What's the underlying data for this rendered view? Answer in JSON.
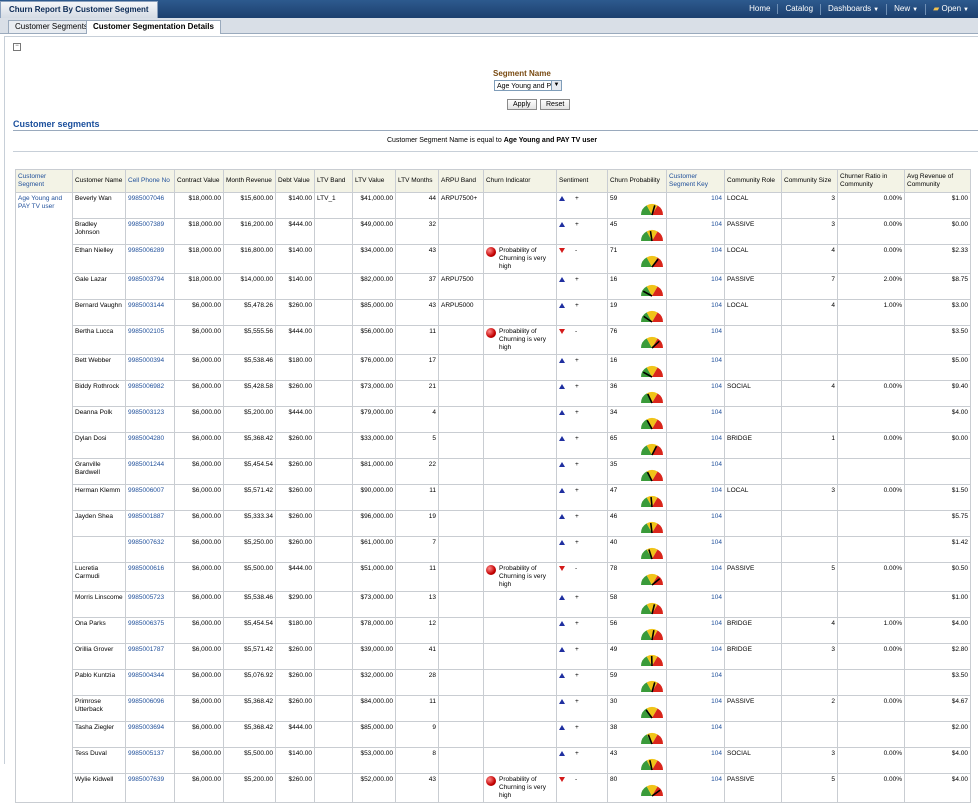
{
  "app": {
    "title": "Churn Report By Customer Segment",
    "nav": [
      "Home",
      "Catalog",
      "Dashboards",
      "New",
      "Open"
    ]
  },
  "tabs": [
    "Customer Segments",
    "Customer Segmentation Details"
  ],
  "prompt": {
    "label": "Segment Name",
    "selected": "Age Young and P",
    "apply": "Apply",
    "reset": "Reset"
  },
  "section": {
    "title": "Customer segments",
    "filter_prefix": "Customer Segment Name is equal to",
    "filter_value": "Age Young and PAY TV user"
  },
  "colors": {
    "topbar": "#1c3f6e",
    "link": "#1f4f9a",
    "header_bg": "#f3f3e6",
    "alert": "#c40000",
    "up": "#1f2fa0",
    "down": "#d41a1a"
  },
  "table": {
    "headers": [
      "Customer Segment",
      "Customer Name",
      "Cell Phone No",
      "Contract Value",
      "Month Revenue",
      "Debt Value",
      "LTV Band",
      "LTV Value",
      "LTV Months",
      "ARPU Band",
      "Churn Indicator",
      "Sentiment",
      "Churn Probability",
      "Customer Segment Key",
      "Community Role",
      "Community Size",
      "Churner Ratio in Community",
      "Avg Revenue of Community"
    ],
    "segment_name": "Age Young and PAY TV user",
    "indicator_text": "Probability of Churning is very high",
    "rows": [
      {
        "name": "Beverly Wan",
        "phone": "9985007046",
        "contract": "$18,000.00",
        "month": "$15,600.00",
        "debt": "$140.00",
        "ltvband": "LTV_1",
        "ltv": "$41,000.00",
        "months": "44",
        "arpu": "ARPU7500+",
        "ind": false,
        "sent": "up",
        "sign": "+",
        "prob": "59",
        "key": "104",
        "role": "LOCAL",
        "size": "3",
        "ratio": "0.00%",
        "avg": "$1.00"
      },
      {
        "name": "Bradley Johnson",
        "phone": "9985007389",
        "contract": "$18,000.00",
        "month": "$16,200.00",
        "debt": "$444.00",
        "ltvband": "",
        "ltv": "$49,000.00",
        "months": "32",
        "arpu": "",
        "ind": false,
        "sent": "up",
        "sign": "+",
        "prob": "45",
        "key": "104",
        "role": "PASSIVE",
        "size": "3",
        "ratio": "0.00%",
        "avg": "$0.00"
      },
      {
        "name": "Ethan Nielley",
        "phone": "9985006289",
        "contract": "$18,000.00",
        "month": "$16,800.00",
        "debt": "$140.00",
        "ltvband": "",
        "ltv": "$34,000.00",
        "months": "43",
        "arpu": "",
        "ind": true,
        "sent": "down",
        "sign": "-",
        "prob": "71",
        "key": "104",
        "role": "LOCAL",
        "size": "4",
        "ratio": "0.00%",
        "avg": "$2.33"
      },
      {
        "name": "Gale Lazar",
        "phone": "9985003794",
        "contract": "$18,000.00",
        "month": "$14,000.00",
        "debt": "$140.00",
        "ltvband": "",
        "ltv": "$82,000.00",
        "months": "37",
        "arpu": "ARPU7500",
        "ind": false,
        "sent": "up",
        "sign": "+",
        "prob": "16",
        "key": "104",
        "role": "PASSIVE",
        "size": "7",
        "ratio": "2.00%",
        "avg": "$8.75"
      },
      {
        "name": "Bernard Vaughn",
        "phone": "9985003144",
        "contract": "$6,000.00",
        "month": "$5,478.26",
        "debt": "$260.00",
        "ltvband": "",
        "ltv": "$85,000.00",
        "months": "43",
        "arpu": "ARPU5000",
        "ind": false,
        "sent": "up",
        "sign": "+",
        "prob": "19",
        "key": "104",
        "role": "LOCAL",
        "size": "4",
        "ratio": "1.00%",
        "avg": "$3.00"
      },
      {
        "name": "Bertha Lucca",
        "phone": "9985002105",
        "contract": "$6,000.00",
        "month": "$5,555.56",
        "debt": "$444.00",
        "ltvband": "",
        "ltv": "$56,000.00",
        "months": "11",
        "arpu": "",
        "ind": true,
        "sent": "down",
        "sign": "-",
        "prob": "76",
        "key": "104",
        "role": "",
        "size": "",
        "ratio": "",
        "avg": "$3.50"
      },
      {
        "name": "Bett Webber",
        "phone": "9985000394",
        "contract": "$6,000.00",
        "month": "$5,538.46",
        "debt": "$180.00",
        "ltvband": "",
        "ltv": "$76,000.00",
        "months": "17",
        "arpu": "",
        "ind": false,
        "sent": "up",
        "sign": "+",
        "prob": "16",
        "key": "104",
        "role": "",
        "size": "",
        "ratio": "",
        "avg": "$5.00"
      },
      {
        "name": "Biddy Rothrock",
        "phone": "9985006982",
        "contract": "$6,000.00",
        "month": "$5,428.58",
        "debt": "$260.00",
        "ltvband": "",
        "ltv": "$73,000.00",
        "months": "21",
        "arpu": "",
        "ind": false,
        "sent": "up",
        "sign": "+",
        "prob": "36",
        "key": "104",
        "role": "SOCIAL",
        "size": "4",
        "ratio": "0.00%",
        "avg": "$9.40"
      },
      {
        "name": "Deanna Polk",
        "phone": "9985003123",
        "contract": "$6,000.00",
        "month": "$5,200.00",
        "debt": "$444.00",
        "ltvband": "",
        "ltv": "$79,000.00",
        "months": "4",
        "arpu": "",
        "ind": false,
        "sent": "up",
        "sign": "+",
        "prob": "34",
        "key": "104",
        "role": "",
        "size": "",
        "ratio": "",
        "avg": "$4.00"
      },
      {
        "name": "Dylan Dosi",
        "phone": "9985004280",
        "contract": "$6,000.00",
        "month": "$5,368.42",
        "debt": "$260.00",
        "ltvband": "",
        "ltv": "$33,000.00",
        "months": "5",
        "arpu": "",
        "ind": false,
        "sent": "up",
        "sign": "+",
        "prob": "65",
        "key": "104",
        "role": "BRIDGE",
        "size": "1",
        "ratio": "0.00%",
        "avg": "$0.00"
      },
      {
        "name": "Granville Bardwell",
        "phone": "9985001244",
        "contract": "$6,000.00",
        "month": "$5,454.54",
        "debt": "$260.00",
        "ltvband": "",
        "ltv": "$81,000.00",
        "months": "22",
        "arpu": "",
        "ind": false,
        "sent": "up",
        "sign": "+",
        "prob": "35",
        "key": "104",
        "role": "",
        "size": "",
        "ratio": "",
        "avg": ""
      },
      {
        "name": "Herman Klemm",
        "phone": "9985006007",
        "contract": "$6,000.00",
        "month": "$5,571.42",
        "debt": "$260.00",
        "ltvband": "",
        "ltv": "$90,000.00",
        "months": "11",
        "arpu": "",
        "ind": false,
        "sent": "up",
        "sign": "+",
        "prob": "47",
        "key": "104",
        "role": "LOCAL",
        "size": "3",
        "ratio": "0.00%",
        "avg": "$1.50"
      },
      {
        "name": "Jayden Shea",
        "phone": "9985001887",
        "contract": "$6,000.00",
        "month": "$5,333.34",
        "debt": "$260.00",
        "ltvband": "",
        "ltv": "$96,000.00",
        "months": "19",
        "arpu": "",
        "ind": false,
        "sent": "up",
        "sign": "+",
        "prob": "46",
        "key": "104",
        "role": "",
        "size": "",
        "ratio": "",
        "avg": "$5.75"
      },
      {
        "name": "",
        "phone": "9985007632",
        "contract": "$6,000.00",
        "month": "$5,250.00",
        "debt": "$260.00",
        "ltvband": "",
        "ltv": "$61,000.00",
        "months": "7",
        "arpu": "",
        "ind": false,
        "sent": "up",
        "sign": "+",
        "prob": "40",
        "key": "104",
        "role": "",
        "size": "",
        "ratio": "",
        "avg": "$1.42"
      },
      {
        "name": "Lucretia Carmudi",
        "phone": "9985000616",
        "contract": "$6,000.00",
        "month": "$5,500.00",
        "debt": "$444.00",
        "ltvband": "",
        "ltv": "$51,000.00",
        "months": "11",
        "arpu": "",
        "ind": true,
        "sent": "down",
        "sign": "-",
        "prob": "78",
        "key": "104",
        "role": "PASSIVE",
        "size": "5",
        "ratio": "0.00%",
        "avg": "$0.50"
      },
      {
        "name": "Morris Linscome",
        "phone": "9985005723",
        "contract": "$6,000.00",
        "month": "$5,538.46",
        "debt": "$290.00",
        "ltvband": "",
        "ltv": "$73,000.00",
        "months": "13",
        "arpu": "",
        "ind": false,
        "sent": "up",
        "sign": "+",
        "prob": "58",
        "key": "104",
        "role": "",
        "size": "",
        "ratio": "",
        "avg": "$1.00"
      },
      {
        "name": "Ona Parks",
        "phone": "9985006375",
        "contract": "$6,000.00",
        "month": "$5,454.54",
        "debt": "$180.00",
        "ltvband": "",
        "ltv": "$78,000.00",
        "months": "12",
        "arpu": "",
        "ind": false,
        "sent": "up",
        "sign": "+",
        "prob": "56",
        "key": "104",
        "role": "BRIDGE",
        "size": "4",
        "ratio": "1.00%",
        "avg": "$4.00"
      },
      {
        "name": "Orillia Grover",
        "phone": "9985001787",
        "contract": "$6,000.00",
        "month": "$5,571.42",
        "debt": "$260.00",
        "ltvband": "",
        "ltv": "$39,000.00",
        "months": "41",
        "arpu": "",
        "ind": false,
        "sent": "up",
        "sign": "+",
        "prob": "49",
        "key": "104",
        "role": "BRIDGE",
        "size": "3",
        "ratio": "0.00%",
        "avg": "$2.80"
      },
      {
        "name": "Pablo Kuntzia",
        "phone": "9985004344",
        "contract": "$6,000.00",
        "month": "$5,076.92",
        "debt": "$260.00",
        "ltvband": "",
        "ltv": "$32,000.00",
        "months": "28",
        "arpu": "",
        "ind": false,
        "sent": "up",
        "sign": "+",
        "prob": "59",
        "key": "104",
        "role": "",
        "size": "",
        "ratio": "",
        "avg": "$3.50"
      },
      {
        "name": "Primrose Utterback",
        "phone": "9985006096",
        "contract": "$6,000.00",
        "month": "$5,368.42",
        "debt": "$260.00",
        "ltvband": "",
        "ltv": "$84,000.00",
        "months": "11",
        "arpu": "",
        "ind": false,
        "sent": "up",
        "sign": "+",
        "prob": "30",
        "key": "104",
        "role": "PASSIVE",
        "size": "2",
        "ratio": "0.00%",
        "avg": "$4.67"
      },
      {
        "name": "Tasha Ziegler",
        "phone": "9985003694",
        "contract": "$6,000.00",
        "month": "$5,368.42",
        "debt": "$444.00",
        "ltvband": "",
        "ltv": "$85,000.00",
        "months": "9",
        "arpu": "",
        "ind": false,
        "sent": "up",
        "sign": "+",
        "prob": "38",
        "key": "104",
        "role": "",
        "size": "",
        "ratio": "",
        "avg": "$2.00"
      },
      {
        "name": "Tess Duval",
        "phone": "9985005137",
        "contract": "$6,000.00",
        "month": "$5,500.00",
        "debt": "$140.00",
        "ltvband": "",
        "ltv": "$53,000.00",
        "months": "8",
        "arpu": "",
        "ind": false,
        "sent": "up",
        "sign": "+",
        "prob": "43",
        "key": "104",
        "role": "SOCIAL",
        "size": "3",
        "ratio": "0.00%",
        "avg": "$4.00"
      },
      {
        "name": "Wylie Kidwell",
        "phone": "9985007639",
        "contract": "$6,000.00",
        "month": "$5,200.00",
        "debt": "$260.00",
        "ltvband": "",
        "ltv": "$52,000.00",
        "months": "43",
        "arpu": "",
        "ind": true,
        "sent": "down",
        "sign": "-",
        "prob": "80",
        "key": "104",
        "role": "PASSIVE",
        "size": "5",
        "ratio": "0.00%",
        "avg": "$4.00"
      }
    ]
  }
}
